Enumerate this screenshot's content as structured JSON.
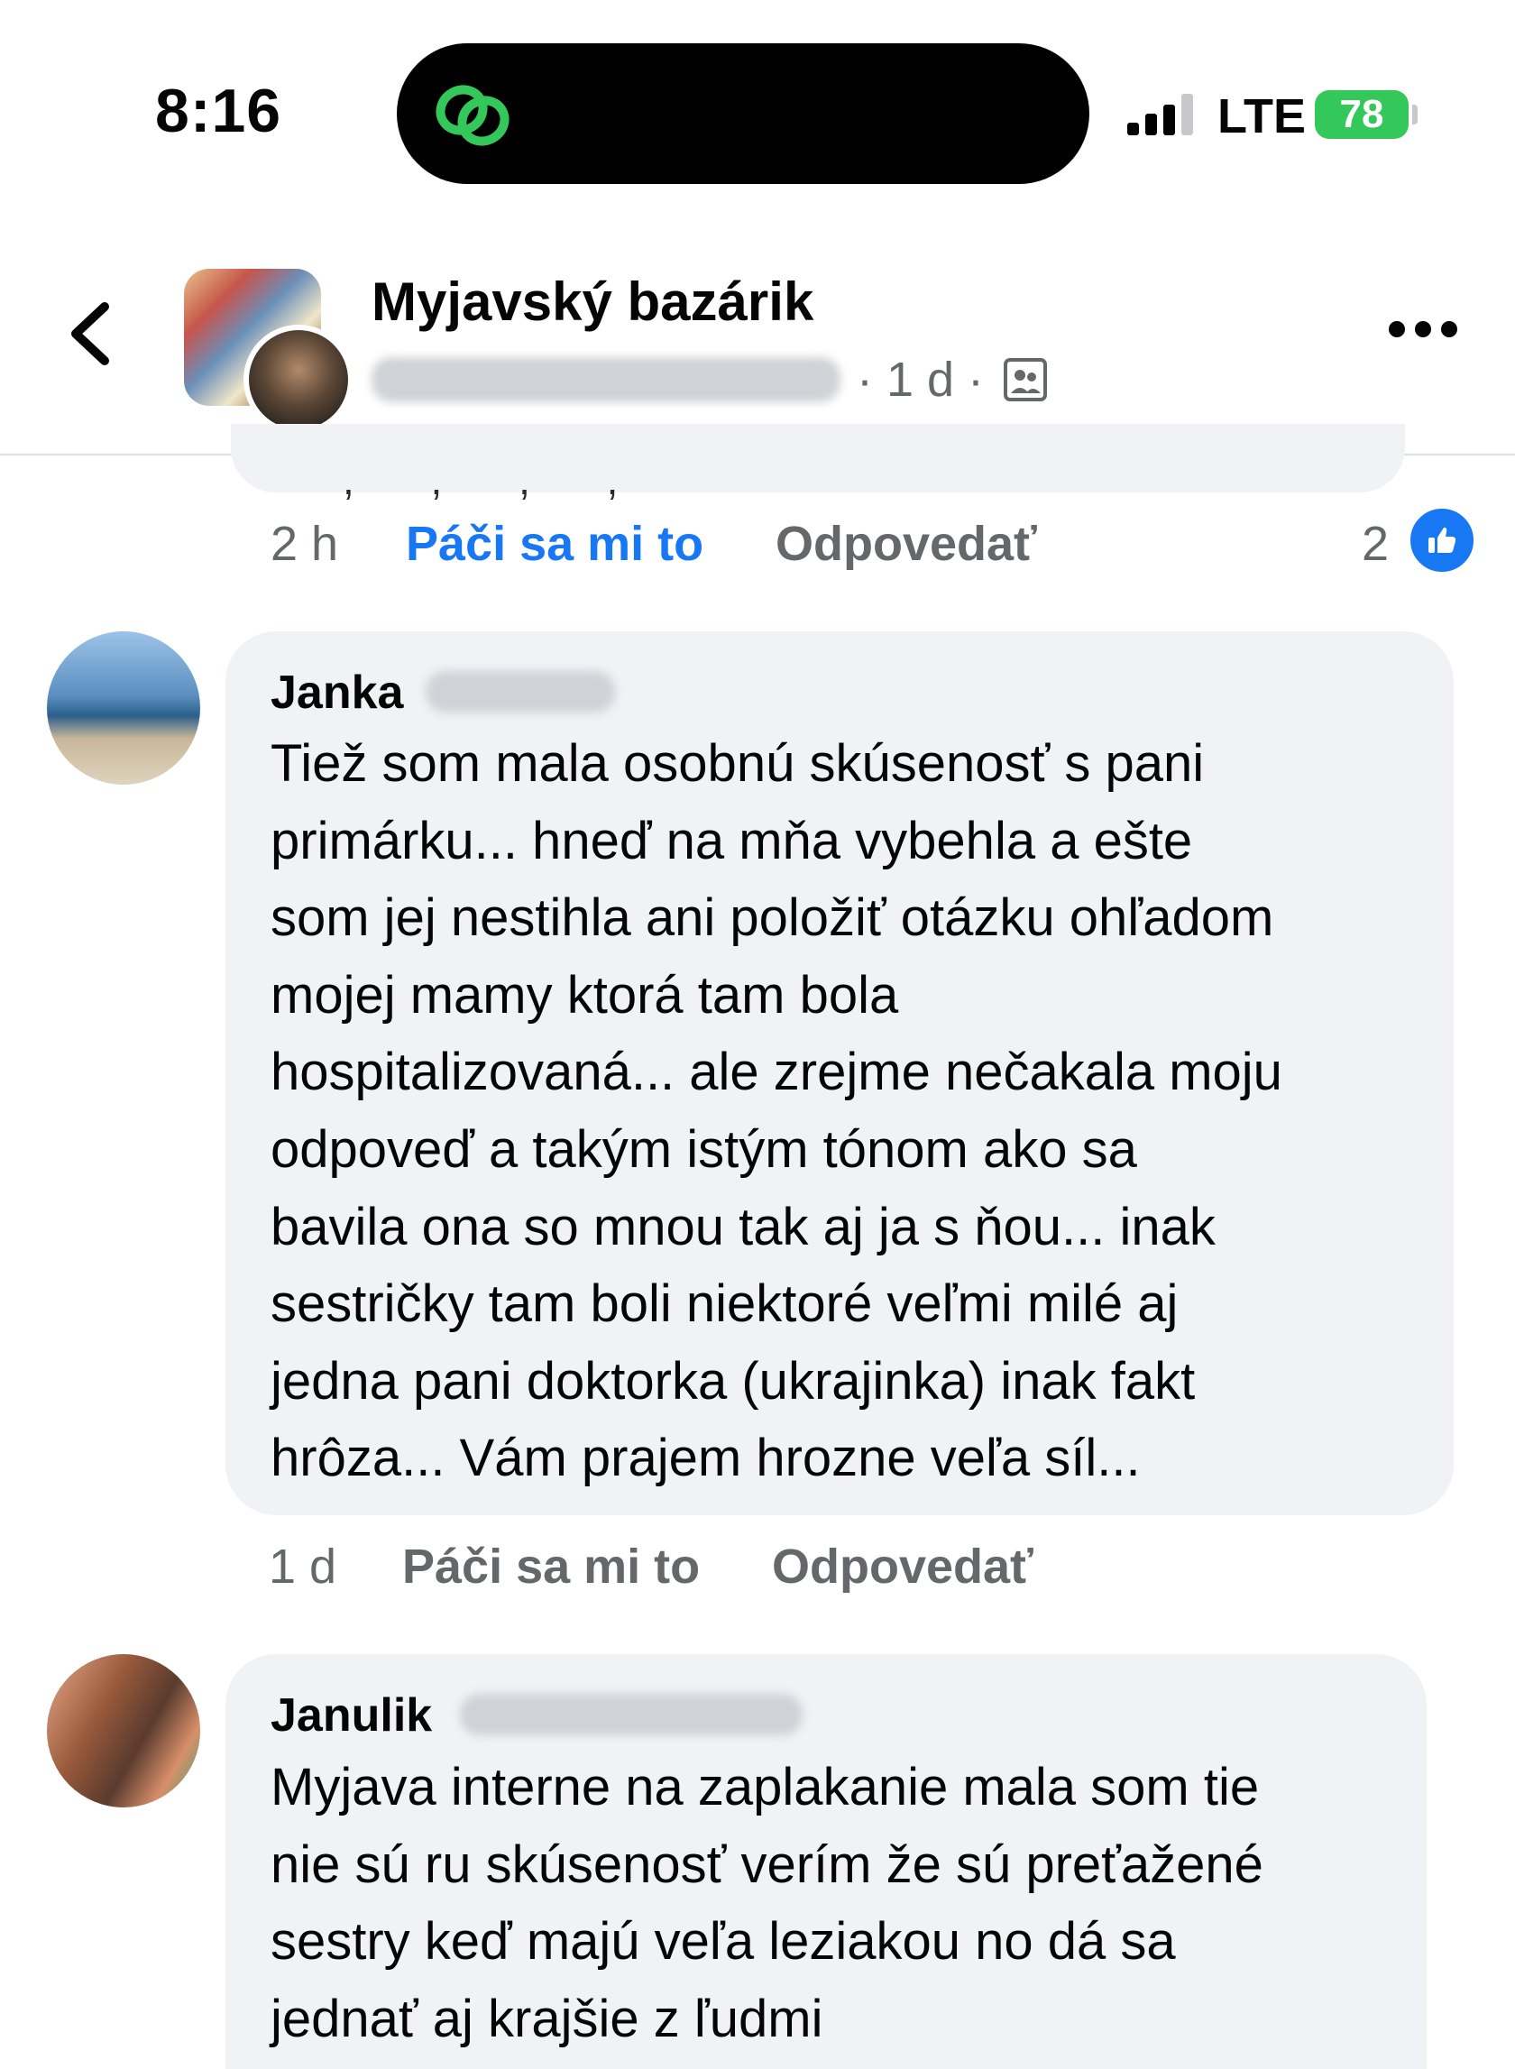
{
  "status_bar": {
    "time": "8:16",
    "network": "LTE",
    "battery": "78",
    "island_icon": "link-chain-icon",
    "accent_green": "#34c759"
  },
  "header": {
    "group_name": "Myjavský bazárik",
    "meta_age": "· 1 d ·",
    "back_icon": "chevron-left-icon",
    "privacy_icon": "group-members-icon",
    "more_icon": "more-dots-icon"
  },
  "previous_comment": {
    "time": "2 h",
    "like_label": "Páči sa mi to",
    "reply_label": "Odpovedať",
    "reaction_count": "2",
    "reaction_icon": "thumbs-up-icon",
    "like_color": "#1877f2"
  },
  "comments": [
    {
      "author": "Janka",
      "text": "Tiež som mala osobnú skúsenosť s pani\nprimárku... hneď na mňa vybehla a ešte\nsom jej nestihla ani položiť otázku ohľadom\nmojej mamy ktorá tam bola\nhospitalizovaná... ale zrejme nečakala moju\nodpoveď a takým istým tónom ako sa\nbavila ona so mnou tak aj ja s ňou... inak\nsestričky tam boli niektoré veľmi milé aj\njedna pani doktorka (ukrajinka) inak fakt\nhrôza... Vám prajem hrozne veľa síl...",
      "time": "1 d",
      "like_label": "Páči sa mi to",
      "reply_label": "Odpovedať"
    },
    {
      "author": "Janulik",
      "text": "Myjava interne na zaplakanie mala som tie\nnie sú ru skúsenosť verím že sú preťažené\nsestry keď majú veľa leziakou no dá sa\njednať aj krajšie z ľudmi"
    }
  ]
}
